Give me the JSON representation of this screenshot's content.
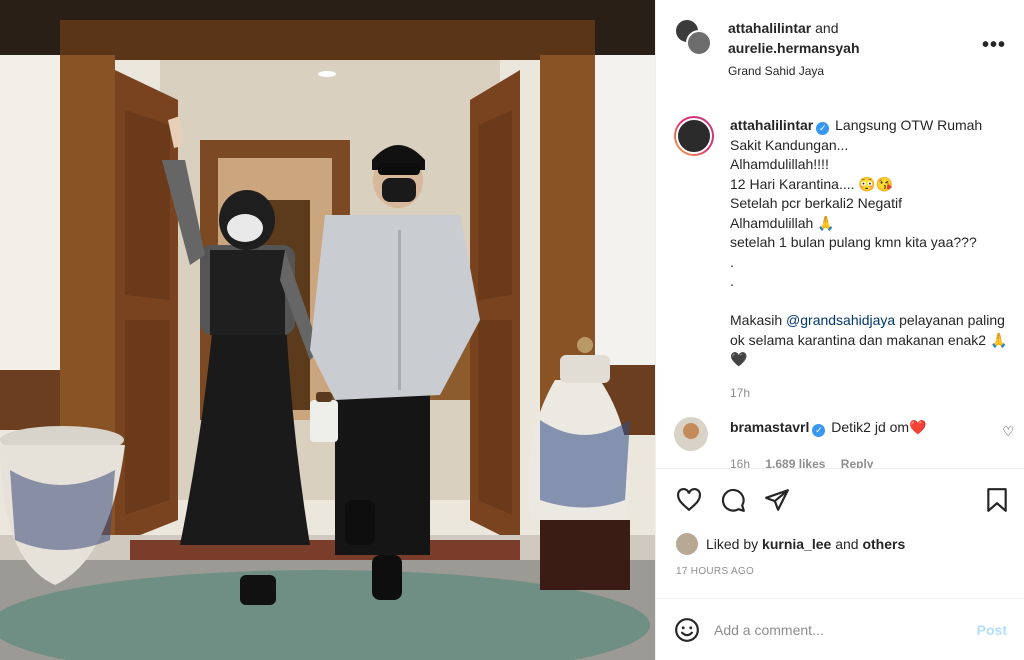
{
  "header": {
    "user1": "attahalilintar",
    "and_word": "and",
    "user2": "aurelie.hermansyah",
    "location": "Grand Sahid Jaya",
    "more_icon": "more-horizontal-icon"
  },
  "caption": {
    "username": "attahalilintar",
    "verified_icon": "verified-badge-icon",
    "lines": [
      "Langsung OTW Rumah",
      "Sakit Kandungan...",
      "Alhamdulillah!!!!",
      "12 Hari Karantina.... 😳😘",
      "Setelah pcr berkali2 Negatif",
      "Alhamdulillah 🙏",
      "setelah 1 bulan pulang kmn kita yaa???",
      ".",
      "."
    ],
    "thanks_prefix": "Makasih ",
    "mention": "@grandsahidjaya",
    "thanks_suffix": " pelayanan paling ok selama karantina dan makanan enak2 🙏🖤",
    "time": "17h"
  },
  "comment": {
    "username": "bramastavrl",
    "text": "Detik2 jd om❤️",
    "time": "16h",
    "likes": "1,689 likes",
    "reply": "Reply",
    "like_icon": "heart-icon"
  },
  "actions": {
    "like_icon": "heart-icon",
    "comment_icon": "comment-icon",
    "share_icon": "share-icon",
    "save_icon": "bookmark-icon"
  },
  "likes": {
    "prefix": "Liked by ",
    "user": "kurnia_lee",
    "middle": " and ",
    "others": "others"
  },
  "timestamp": "17 HOURS AGO",
  "add_comment": {
    "placeholder": "Add a comment...",
    "post_label": "Post",
    "emoji_icon": "smiley-icon"
  },
  "colors": {
    "link": "#00376b",
    "post_disabled": "#b2dffc",
    "verified": "#3897f0",
    "muted": "#8e8e8e"
  }
}
